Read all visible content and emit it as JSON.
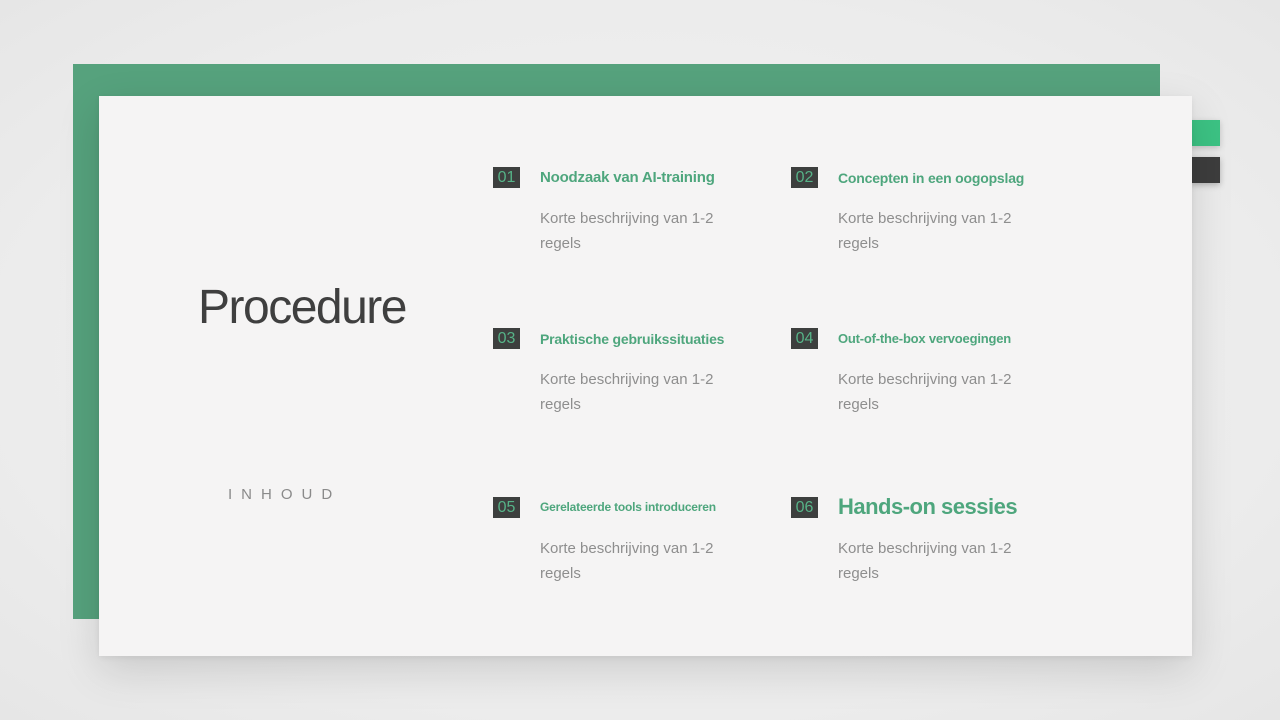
{
  "slide": {
    "title": "Procedure",
    "subtitle": "INHOUD",
    "items": [
      {
        "number": "01",
        "title": "Noodzaak van AI-training",
        "description": "Korte beschrijving van 1-2 regels"
      },
      {
        "number": "02",
        "title": "Concepten in een oogopslag",
        "description": "Korte beschrijving van 1-2 regels"
      },
      {
        "number": "03",
        "title": "Praktische gebruikssituaties",
        "description": "Korte beschrijving van 1-2 regels"
      },
      {
        "number": "04",
        "title": "Out-of-the-box vervoegingen",
        "description": "Korte beschrijving van 1-2 regels"
      },
      {
        "number": "05",
        "title": "Gerelateerde tools introduceren",
        "description": "Korte beschrijving van 1-2 regels"
      },
      {
        "number": "06",
        "title": "Hands-on sessies",
        "description": "Korte beschrijving van 1-2 regels"
      }
    ]
  },
  "colors": {
    "accent_green": "#4ea67d",
    "back_panel_green": "#56a27d",
    "tab_green": "#3cc384",
    "tab_dark": "#3d3d3d",
    "number_box": "#3d3f3e"
  }
}
